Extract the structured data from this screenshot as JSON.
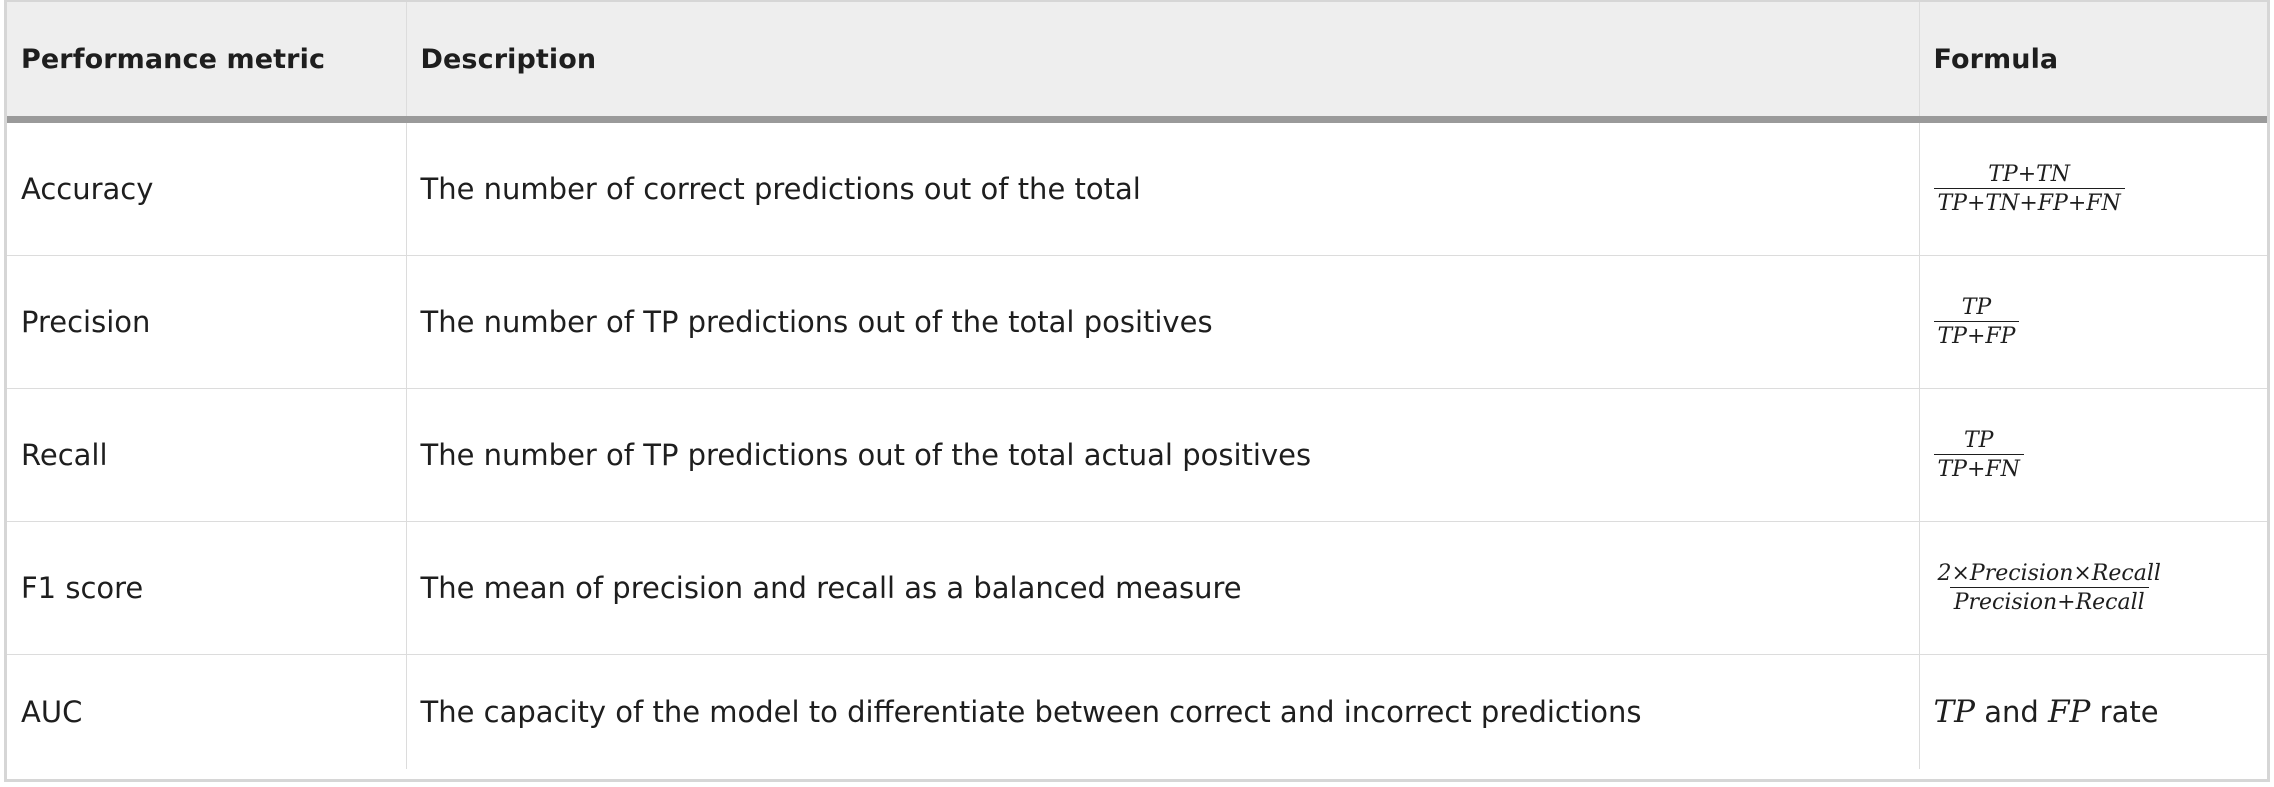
{
  "table": {
    "headers": [
      "Performance metric",
      "Description",
      "Formula"
    ],
    "rows": [
      {
        "metric": "Accuracy",
        "description": "The number of correct predictions out of the total",
        "formula": {
          "numerator": "TP+TN",
          "denominator": "TP+TN+FP+FN"
        }
      },
      {
        "metric": "Precision",
        "description": "The number of TP predictions out of the total positives",
        "formula": {
          "numerator": "TP",
          "denominator": "TP+FP"
        }
      },
      {
        "metric": "Recall",
        "description": "The number of TP predictions out of the total actual positives",
        "formula": {
          "numerator": "TP",
          "denominator": "TP+FN"
        }
      },
      {
        "metric": "F1 score",
        "description": "The mean of precision and recall as a balanced measure",
        "formula": {
          "numerator": "2×Precision×Recall",
          "denominator": "Precision+Recall"
        }
      },
      {
        "metric": "AUC",
        "description": "The capacity of the model to differentiate between correct and incorrect predictions",
        "formula": {
          "term1": "TP",
          "connector": "and",
          "term2": "FP",
          "suffix": "rate"
        }
      }
    ]
  },
  "colors": {
    "header_bg": "#eeeeee",
    "header_rule": "#9a9a9a",
    "grid": "#dcdcdc",
    "text": "#1e1e1e"
  }
}
